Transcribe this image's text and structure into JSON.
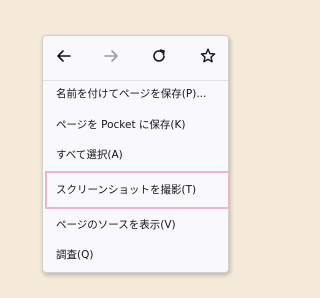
{
  "nav": {
    "back_icon": "arrow-left-icon",
    "forward_icon": "arrow-right-icon",
    "reload_icon": "reload-icon",
    "bookmark_icon": "star-outline-icon"
  },
  "menu": {
    "items": [
      {
        "label": "名前を付けてページを保存(P)..."
      },
      {
        "label": "ページを Pocket に保存(K)"
      },
      {
        "label": "すべて選択(A)"
      },
      {
        "label": "スクリーンショットを撮影(T)"
      },
      {
        "label": "ページのソースを表示(V)"
      },
      {
        "label": "調査(Q)"
      }
    ]
  },
  "colors": {
    "background": "#f6ebd9",
    "menu_bg": "#f9f9fb",
    "highlight_border": "#f0b4c8",
    "icon_active": "#15141a",
    "icon_disabled": "#9a9aa0"
  }
}
